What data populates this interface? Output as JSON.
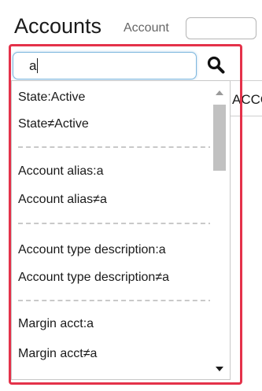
{
  "header": {
    "title": "Accounts",
    "account_label": "Account",
    "account_value": ""
  },
  "background": {
    "partial_field_text": "ACCO"
  },
  "search": {
    "value": "a",
    "icon": "search-icon"
  },
  "dropdown": {
    "groups": [
      {
        "items": [
          "State:Active",
          "State≠Active"
        ]
      },
      {
        "items": [
          "Account alias:a",
          "Account alias≠a"
        ]
      },
      {
        "items": [
          "Account type description:a",
          "Account type description≠a"
        ]
      },
      {
        "items": [
          "Margin acct:a",
          "Margin acct≠a"
        ]
      }
    ]
  },
  "colors": {
    "highlight_frame": "#e4324a",
    "input_focus": "#7fb8de"
  }
}
